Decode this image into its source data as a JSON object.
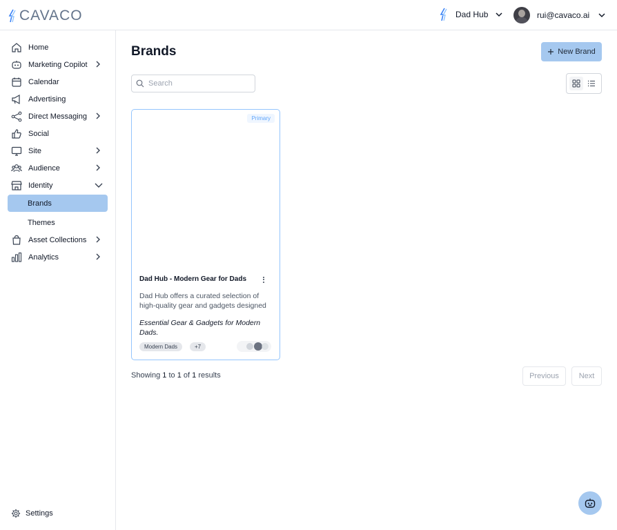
{
  "app": {
    "logo_text": "CAVACO"
  },
  "topbar": {
    "brand_switcher": "Dad Hub",
    "user_email": "rui@cavaco.ai"
  },
  "sidebar": {
    "items": [
      {
        "label": "Home",
        "icon": "home-icon"
      },
      {
        "label": "Marketing Copilot",
        "icon": "copilot-icon",
        "expandable": true
      },
      {
        "label": "Calendar",
        "icon": "calendar-icon"
      },
      {
        "label": "Advertising",
        "icon": "megaphone-icon"
      },
      {
        "label": "Direct Messaging",
        "icon": "share-icon",
        "expandable": true
      },
      {
        "label": "Social",
        "icon": "thumbs-up-icon"
      },
      {
        "label": "Site",
        "icon": "monitor-icon",
        "expandable": true
      },
      {
        "label": "Audience",
        "icon": "users-icon",
        "expandable": true
      },
      {
        "label": "Identity",
        "icon": "storefront-icon",
        "expanded": true
      },
      {
        "label": "Brands",
        "active": true
      },
      {
        "label": "Themes"
      },
      {
        "label": "Asset Collections",
        "icon": "shopping-bag-icon",
        "expandable": true
      },
      {
        "label": "Analytics",
        "icon": "bar-chart-icon",
        "expandable": true
      }
    ],
    "settings_label": "Settings"
  },
  "main": {
    "title": "Brands",
    "new_button": "New Brand",
    "search_placeholder": "Search",
    "view_mode": "grid"
  },
  "brand_card": {
    "badge": "Primary",
    "title": "Dad Hub - Modern Gear for Dads",
    "description": "Dad Hub offers a curated selection of high-quality gear and gadgets designed for modern dads.",
    "tagline": "Essential Gear & Gadgets for Modern Dads.",
    "chips": [
      "Modern Dads",
      "+7"
    ]
  },
  "pagination": {
    "showing": "Showing",
    "from": "1",
    "to_word": "to",
    "to": "1",
    "of_word": "of",
    "total": "1",
    "results_word": "results",
    "previous": "Previous",
    "next": "Next"
  },
  "colors": {
    "accent": "#a5c8ef",
    "card_border": "#93c5fd",
    "badge_text": "#60a5fa"
  }
}
